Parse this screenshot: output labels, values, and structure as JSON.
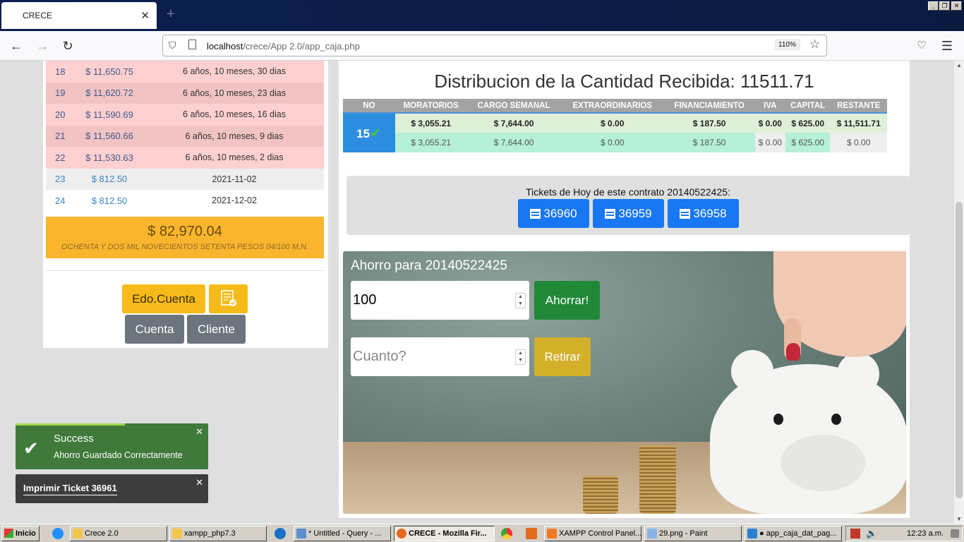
{
  "browser": {
    "tab_title": "CRECE",
    "url_host": "localhost",
    "url_path": "/crece/App 2.0/app_caja.php",
    "zoom": "110%"
  },
  "payments": {
    "rows": [
      {
        "no": "18",
        "amount": "$ 11,650.75",
        "desc": "6 años, 10 meses, 30 dias"
      },
      {
        "no": "19",
        "amount": "$ 11,620.72",
        "desc": "6 años, 10 meses, 23 dias"
      },
      {
        "no": "20",
        "amount": "$ 11,590.69",
        "desc": "6 años, 10 meses, 16 dias"
      },
      {
        "no": "21",
        "amount": "$ 11,560.66",
        "desc": "6 años, 10 meses, 9 dias"
      },
      {
        "no": "22",
        "amount": "$ 11,530.63",
        "desc": "6 años, 10 meses, 2 dias"
      },
      {
        "no": "23",
        "amount": "$ 812.50",
        "desc": "2021-11-02"
      },
      {
        "no": "24",
        "amount": "$ 812.50",
        "desc": "2021-12-02"
      }
    ],
    "total": "$ 82,970.04",
    "total_words": "OCHENTA Y DOS MIL NOVECIENTOS SETENTA PESOS 04/100 M.N."
  },
  "actions": {
    "edo_cuenta": "Edo.Cuenta",
    "cuenta": "Cuenta",
    "cliente": "Cliente"
  },
  "distribution": {
    "title": "Distribucion de la Cantidad Recibida: 11511.71",
    "headers": [
      "NO",
      "MORATORIOS",
      "CARGO SEMANAL",
      "EXTRAORDINARIOS",
      "FINANCIAMIENTO",
      "IVA",
      "CAPITAL",
      "RESTANTE"
    ],
    "no": "15",
    "row1": [
      "$ 3,055.21",
      "$ 7,644.00",
      "$ 0.00",
      "$ 187.50",
      "$ 0.00",
      "$ 625.00",
      "$ 11,511.71"
    ],
    "row2": [
      "$ 3,055.21",
      "$ 7,644.00",
      "$ 0.00",
      "$ 187.50",
      "$ 0.00",
      "$ 625.00",
      "$ 0.00"
    ]
  },
  "tickets": {
    "title": "Tickets de Hoy de este contrato 20140522425:",
    "items": [
      "36960",
      "36959",
      "36958"
    ]
  },
  "savings": {
    "title": "Ahorro para 20140522425",
    "amount_value": "100",
    "save_label": "Ahorrar!",
    "withdraw_placeholder": "Cuanto?",
    "withdraw_label": "Retirar"
  },
  "toasts": {
    "success_title": "Success",
    "success_msg": "Ahorro Guardado Correctamente",
    "print_label": "Imprimir Ticket 36961"
  },
  "taskbar": {
    "start": "Inicio",
    "items": [
      "Crece 2.0",
      "xampp_php7.3",
      "* Untitled - Query - ...",
      "CRECE - Mozilla Fir...",
      "XAMPP Control Panel...",
      "29.png - Paint",
      "● app_caja_dat_pag..."
    ],
    "clock": "12:23 a.m."
  }
}
